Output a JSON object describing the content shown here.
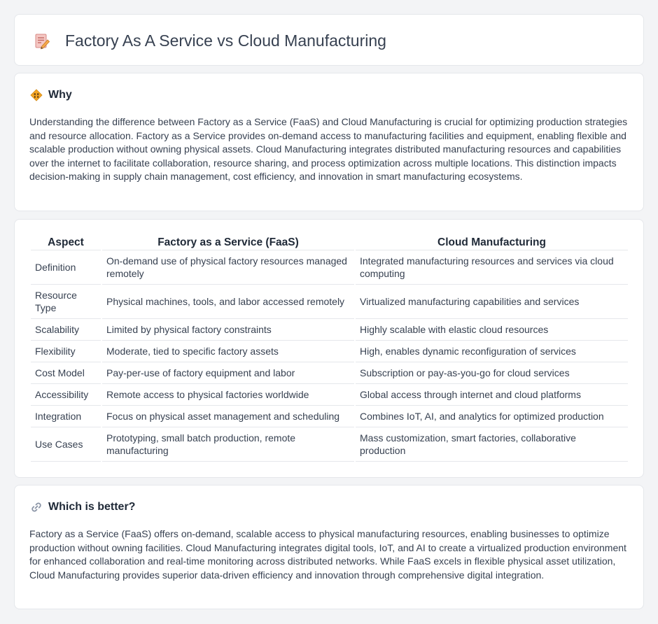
{
  "header": {
    "title": "Factory As A Service vs Cloud Manufacturing",
    "icon": "document-pencil-icon"
  },
  "why": {
    "title": "Why",
    "icon": "diamond-sign-icon",
    "text": "Understanding the difference between Factory as a Service (FaaS) and Cloud Manufacturing is crucial for optimizing production strategies and resource allocation. Factory as a Service provides on-demand access to manufacturing facilities and equipment, enabling flexible and scalable production without owning physical assets. Cloud Manufacturing integrates distributed manufacturing resources and capabilities over the internet to facilitate collaboration, resource sharing, and process optimization across multiple locations. This distinction impacts decision-making in supply chain management, cost efficiency, and innovation in smart manufacturing ecosystems."
  },
  "table": {
    "headers": [
      "Aspect",
      "Factory as a Service (FaaS)",
      "Cloud Manufacturing"
    ],
    "rows": [
      {
        "aspect": "Definition",
        "faas": "On-demand use of physical factory resources managed remotely",
        "cloud": "Integrated manufacturing resources and services via cloud computing"
      },
      {
        "aspect": "Resource Type",
        "faas": "Physical machines, tools, and labor accessed remotely",
        "cloud": "Virtualized manufacturing capabilities and services"
      },
      {
        "aspect": "Scalability",
        "faas": "Limited by physical factory constraints",
        "cloud": "Highly scalable with elastic cloud resources"
      },
      {
        "aspect": "Flexibility",
        "faas": "Moderate, tied to specific factory assets",
        "cloud": "High, enables dynamic reconfiguration of services"
      },
      {
        "aspect": "Cost Model",
        "faas": "Pay-per-use of factory equipment and labor",
        "cloud": "Subscription or pay-as-you-go for cloud services"
      },
      {
        "aspect": "Accessibility",
        "faas": "Remote access to physical factories worldwide",
        "cloud": "Global access through internet and cloud platforms"
      },
      {
        "aspect": "Integration",
        "faas": "Focus on physical asset management and scheduling",
        "cloud": "Combines IoT, AI, and analytics for optimized production"
      },
      {
        "aspect": "Use Cases",
        "faas": "Prototyping, small batch production, remote manufacturing",
        "cloud": "Mass customization, smart factories, collaborative production"
      }
    ]
  },
  "better": {
    "title": "Which is better?",
    "icon": "link-icon",
    "text": "Factory as a Service (FaaS) offers on-demand, scalable access to physical manufacturing resources, enabling businesses to optimize production without owning facilities. Cloud Manufacturing integrates digital tools, IoT, and AI to create a virtualized production environment for enhanced collaboration and real-time monitoring across distributed networks. While FaaS excels in flexible physical asset utilization, Cloud Manufacturing provides superior data-driven efficiency and innovation through comprehensive digital integration."
  }
}
